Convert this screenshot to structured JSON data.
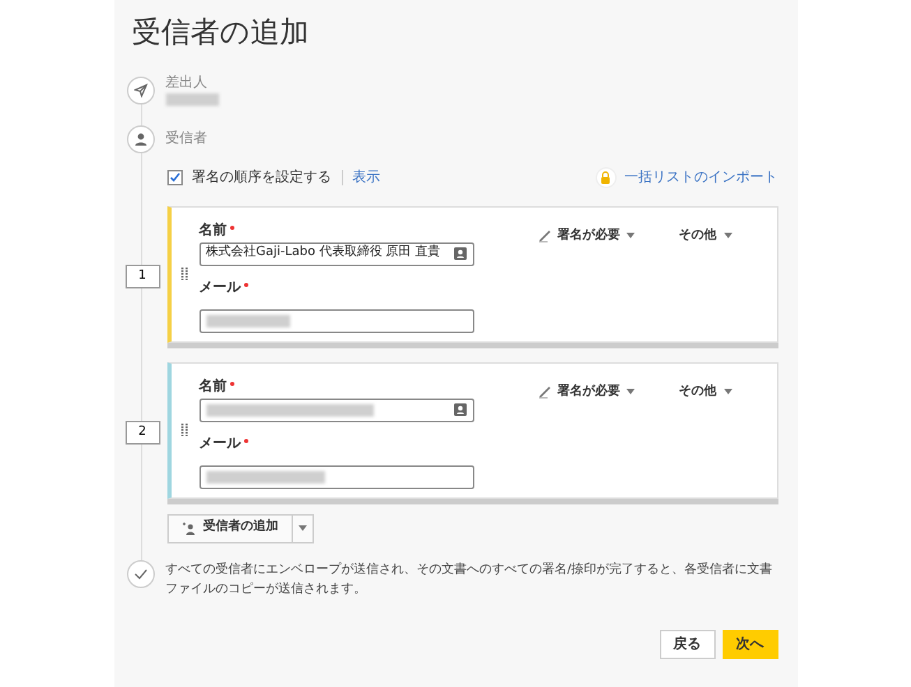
{
  "title": "受信者の追加",
  "sender": {
    "label": "差出人"
  },
  "recipients_section": {
    "label": "受信者",
    "order_checkbox": {
      "label": "署名の順序を設定する",
      "checked": true
    },
    "show_link": "表示",
    "import_link": "一括リストのインポート"
  },
  "recipients": [
    {
      "order": "1",
      "color": "#f5d046",
      "name_label": "名前",
      "name_value": "株式会社Gaji-Labo 代表取締役 原田 直貴",
      "email_label": "メール",
      "action": "署名が必要",
      "other": "その他"
    },
    {
      "order": "2",
      "color": "#9fd6e0",
      "name_label": "名前",
      "email_label": "メール",
      "action": "署名が必要",
      "other": "その他"
    }
  ],
  "add_button": "受信者の追加",
  "footer_note": "すべての受信者にエンベロープが送信され、その文書へのすべての署名/捺印が完了すると、各受信者に文書ファイルのコピーが送信されます。",
  "buttons": {
    "back": "戻る",
    "next": "次へ"
  }
}
